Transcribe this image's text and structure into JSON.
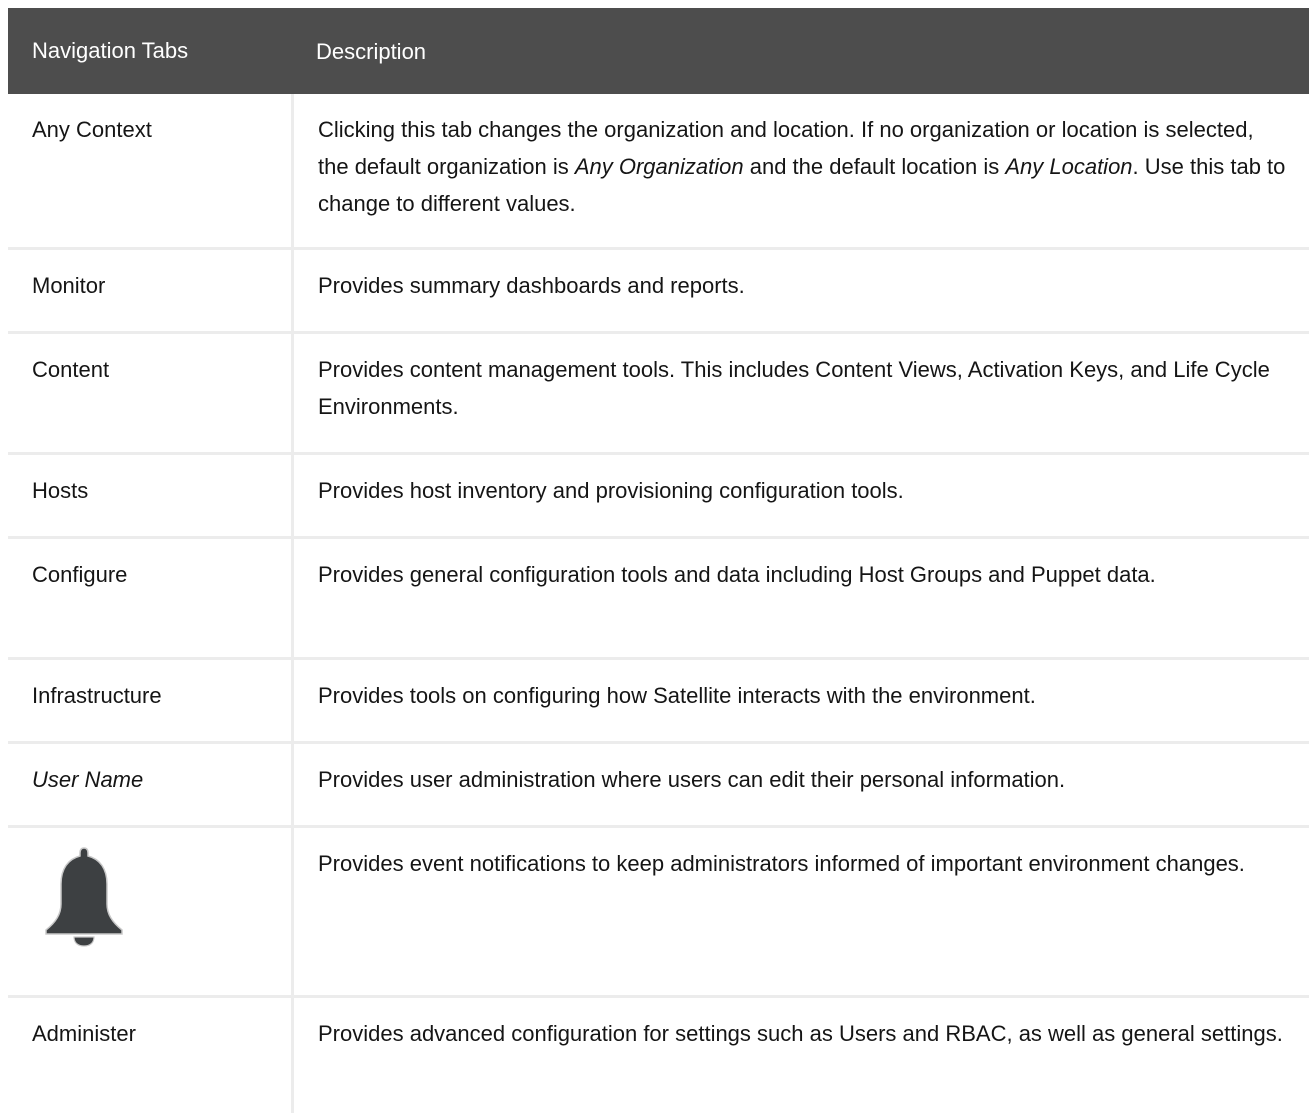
{
  "header": {
    "col1": "Navigation Tabs",
    "col2": "Description"
  },
  "rows": [
    {
      "name": "Any Context",
      "desc_parts": [
        "Clicking this tab changes the organization and location. If no organization or location is selected, the default organization is ",
        "Any Organization",
        " and the default location is ",
        "Any Location",
        ". Use this tab to change to different values."
      ]
    },
    {
      "name": "Monitor",
      "desc": "Provides summary dashboards and reports."
    },
    {
      "name": "Content",
      "desc": "Provides content management tools. This includes Content Views, Activation Keys, and Life Cycle Environments."
    },
    {
      "name": "Hosts",
      "desc": "Provides host inventory and provisioning configuration tools."
    },
    {
      "name": "Configure",
      "desc": "Provides general configuration tools and data including Host Groups and Puppet data."
    },
    {
      "name": "Infrastructure",
      "desc": "Provides tools on configuring how Satellite interacts with the environment."
    },
    {
      "name": "User Name",
      "desc": "Provides user administration where users can edit their personal information."
    },
    {
      "icon": "bell-icon",
      "desc": "Provides event notifications to keep administrators informed of important environment changes."
    },
    {
      "name": "Administer",
      "desc": "Provides advanced configuration for settings such as Users and RBAC, as well as general settings."
    }
  ],
  "colors": {
    "header_bg": "#4d4d4d",
    "header_text": "#ffffff",
    "border": "#ececec",
    "bell_fill": "#3c3f42"
  }
}
